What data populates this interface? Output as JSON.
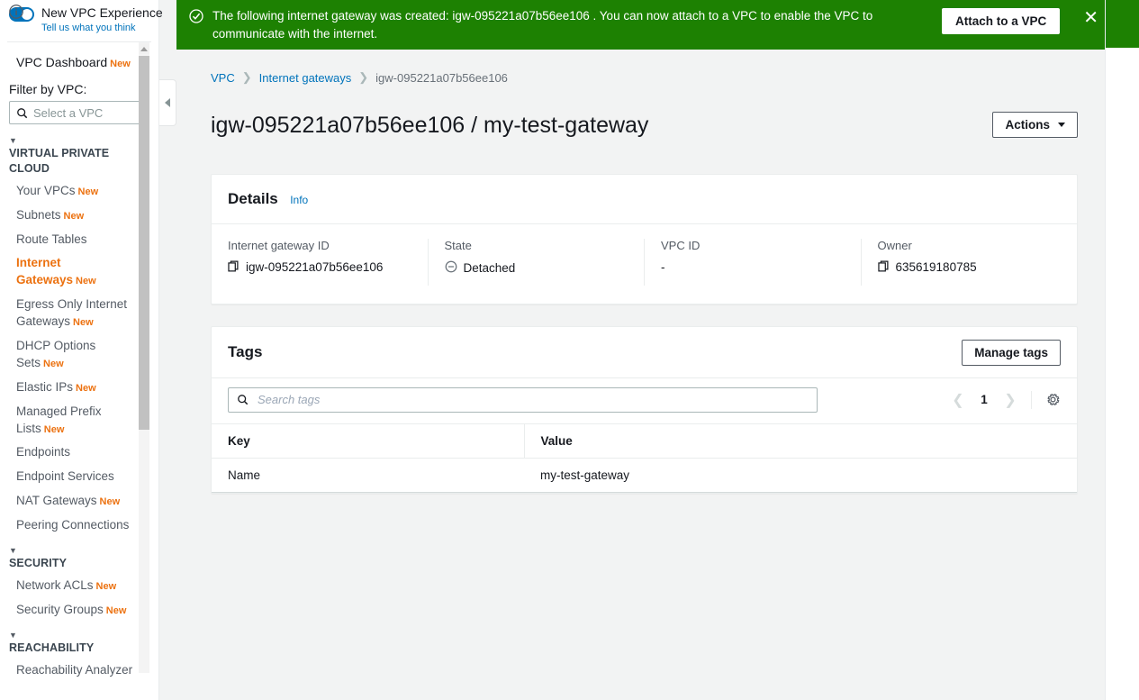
{
  "sidebar": {
    "new_experience": {
      "title": "New VPC Experience",
      "subtitle": "Tell us what you think",
      "toggle_on": true
    },
    "dashboard_label": "VPC Dashboard",
    "dashboard_badge": "New",
    "filter_label": "Filter by VPC:",
    "vpc_select_placeholder": "Select a VPC",
    "groups": [
      {
        "title": "VIRTUAL PRIVATE CLOUD",
        "items": [
          {
            "label": "Your VPCs",
            "badge": "New",
            "active": false
          },
          {
            "label": "Subnets",
            "badge": "New",
            "active": false
          },
          {
            "label": "Route Tables",
            "badge": "",
            "active": false
          },
          {
            "label": "Internet Gateways",
            "badge": "New",
            "active": true
          },
          {
            "label": "Egress Only Internet Gateways",
            "badge": "New",
            "active": false
          },
          {
            "label": "DHCP Options Sets",
            "badge": "New",
            "active": false
          },
          {
            "label": "Elastic IPs",
            "badge": "New",
            "active": false
          },
          {
            "label": "Managed Prefix Lists",
            "badge": "New",
            "active": false
          },
          {
            "label": "Endpoints",
            "badge": "",
            "active": false
          },
          {
            "label": "Endpoint Services",
            "badge": "",
            "active": false
          },
          {
            "label": "NAT Gateways",
            "badge": "New",
            "active": false
          },
          {
            "label": "Peering Connections",
            "badge": "",
            "active": false
          }
        ]
      },
      {
        "title": "SECURITY",
        "items": [
          {
            "label": "Network ACLs",
            "badge": "New",
            "active": false
          },
          {
            "label": "Security Groups",
            "badge": "New",
            "active": false
          }
        ]
      },
      {
        "title": "REACHABILITY",
        "items": [
          {
            "label": "Reachability Analyzer",
            "badge": "",
            "active": false
          }
        ]
      }
    ]
  },
  "flash": {
    "message": "The following internet gateway was created: igw-095221a07b56ee106 . You can now attach to a VPC to enable the VPC to communicate with the internet.",
    "button_label": "Attach to a VPC",
    "background": "#1d8102",
    "icon": "success-check-icon",
    "close_icon": "close-icon"
  },
  "breadcrumb": {
    "root": "VPC",
    "parent": "Internet gateways",
    "current": "igw-095221a07b56ee106"
  },
  "page": {
    "title": "igw-095221a07b56ee106 / my-test-gateway",
    "actions_label": "Actions"
  },
  "details": {
    "title": "Details",
    "info_label": "Info",
    "fields": [
      {
        "label": "Internet gateway ID",
        "value": "igw-095221a07b56ee106",
        "icon": "copy-icon"
      },
      {
        "label": "State",
        "value": "Detached",
        "icon": "detached-circle-minus-icon"
      },
      {
        "label": "VPC ID",
        "value": "-",
        "icon": ""
      },
      {
        "label": "Owner",
        "value": "635619180785",
        "icon": "copy-icon"
      }
    ]
  },
  "tags": {
    "title": "Tags",
    "manage_label": "Manage tags",
    "search_placeholder": "Search tags",
    "search_value": "",
    "page_number": "1",
    "columns": [
      "Key",
      "Value"
    ],
    "rows": [
      {
        "key": "Name",
        "value": "my-test-gateway"
      }
    ]
  },
  "right_rail": {
    "info_icon": "info-circle-icon"
  },
  "colors": {
    "accent_orange": "#ec7211",
    "link_blue": "#0073bb",
    "success_green": "#1d8102",
    "page_bg": "#f2f3f3"
  }
}
